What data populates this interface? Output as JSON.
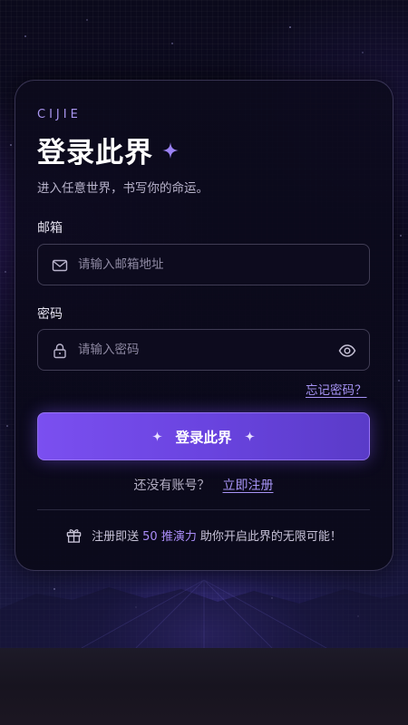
{
  "brand": "CIJIE",
  "title": "登录此界",
  "subtitle": "进入任意世界，书写你的命运。",
  "email": {
    "label": "邮箱",
    "placeholder": "请输入邮箱地址",
    "value": "",
    "icon": "mail-icon"
  },
  "password": {
    "label": "密码",
    "placeholder": "请输入密码",
    "value": "",
    "icon": "lock-icon",
    "toggle_icon": "eye-icon"
  },
  "forgot_link": "忘记密码？",
  "login_button": "登录此界",
  "signup": {
    "prompt": "还没有账号？",
    "link": "立即注册"
  },
  "promo": {
    "icon": "gift-icon",
    "prefix": "注册即送",
    "highlight": "50 推演力",
    "suffix": "助你开启此界的无限可能！"
  },
  "colors": {
    "accent": "#7b4ff0",
    "link": "#a794f5",
    "background": "#0f0c26",
    "card_border": "#5e5780"
  }
}
